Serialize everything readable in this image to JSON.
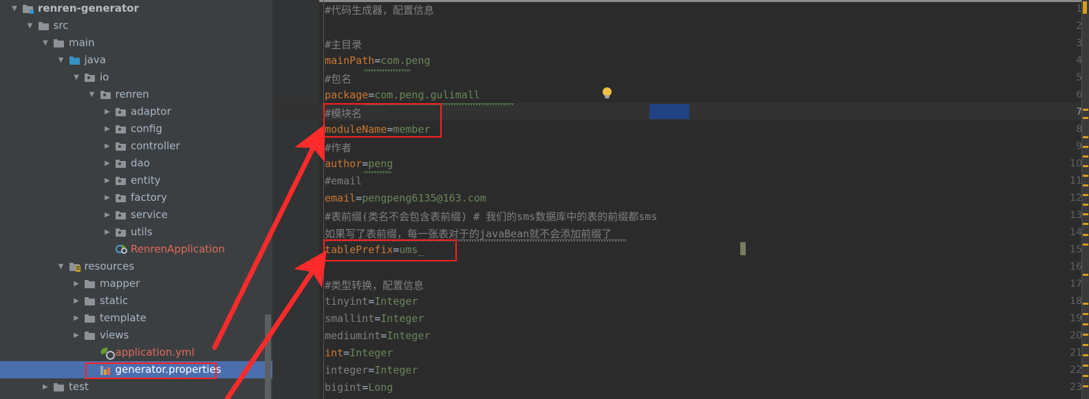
{
  "window": {
    "theme_bg": "#3c3f41",
    "editor_bg": "#2b2b2b",
    "accent_selection": "#4b6eaf",
    "annotation_color": "#ff2020"
  },
  "project_tree": {
    "name": "project-tool-window",
    "items": [
      {
        "label": "renren-generator",
        "indent": 0,
        "arrow": "down",
        "icon": "module-folder-icon",
        "style": "bold",
        "selected": false
      },
      {
        "label": "src",
        "indent": 1,
        "arrow": "down",
        "icon": "folder-icon",
        "style": "normal",
        "selected": false
      },
      {
        "label": "main",
        "indent": 2,
        "arrow": "down",
        "icon": "folder-icon",
        "style": "normal",
        "selected": false
      },
      {
        "label": "java",
        "indent": 3,
        "arrow": "down",
        "icon": "source-folder-icon",
        "style": "normal",
        "selected": false
      },
      {
        "label": "io",
        "indent": 4,
        "arrow": "down",
        "icon": "package-folder-icon",
        "style": "normal",
        "selected": false
      },
      {
        "label": "renren",
        "indent": 5,
        "arrow": "down",
        "icon": "package-folder-icon",
        "style": "normal",
        "selected": false
      },
      {
        "label": "adaptor",
        "indent": 6,
        "arrow": "right",
        "icon": "package-folder-icon",
        "style": "normal",
        "selected": false
      },
      {
        "label": "config",
        "indent": 6,
        "arrow": "right",
        "icon": "package-folder-icon",
        "style": "normal",
        "selected": false
      },
      {
        "label": "controller",
        "indent": 6,
        "arrow": "right",
        "icon": "package-folder-icon",
        "style": "normal",
        "selected": false
      },
      {
        "label": "dao",
        "indent": 6,
        "arrow": "right",
        "icon": "package-folder-icon",
        "style": "normal",
        "selected": false
      },
      {
        "label": "entity",
        "indent": 6,
        "arrow": "right",
        "icon": "package-folder-icon",
        "style": "normal",
        "selected": false
      },
      {
        "label": "factory",
        "indent": 6,
        "arrow": "right",
        "icon": "package-folder-icon",
        "style": "normal",
        "selected": false
      },
      {
        "label": "service",
        "indent": 6,
        "arrow": "right",
        "icon": "package-folder-icon",
        "style": "normal",
        "selected": false
      },
      {
        "label": "utils",
        "indent": 6,
        "arrow": "right",
        "icon": "package-folder-icon",
        "style": "normal",
        "selected": false
      },
      {
        "label": "RenrenApplication",
        "indent": 6,
        "arrow": "none",
        "icon": "spring-boot-class-icon",
        "style": "file-red",
        "selected": false
      },
      {
        "label": "resources",
        "indent": 3,
        "arrow": "down",
        "icon": "resources-folder-icon",
        "style": "normal",
        "selected": false
      },
      {
        "label": "mapper",
        "indent": 4,
        "arrow": "right",
        "icon": "folder-icon",
        "style": "normal",
        "selected": false
      },
      {
        "label": "static",
        "indent": 4,
        "arrow": "right",
        "icon": "folder-icon",
        "style": "normal",
        "selected": false
      },
      {
        "label": "template",
        "indent": 4,
        "arrow": "right",
        "icon": "folder-icon",
        "style": "normal",
        "selected": false
      },
      {
        "label": "views",
        "indent": 4,
        "arrow": "right",
        "icon": "folder-icon",
        "style": "normal",
        "selected": false
      },
      {
        "label": "application.yml",
        "indent": 5,
        "arrow": "none",
        "icon": "spring-yaml-icon",
        "style": "file-red",
        "selected": false
      },
      {
        "label": "generator.properties",
        "indent": 5,
        "arrow": "none",
        "icon": "properties-file-icon",
        "style": "file-sel",
        "selected": true
      },
      {
        "label": "test",
        "indent": 2,
        "arrow": "right",
        "icon": "folder-icon",
        "style": "normal",
        "selected": false
      }
    ]
  },
  "editor": {
    "name": "generator-properties-editor",
    "current_line": 7,
    "caret_line": 15,
    "caret_text_offset": "tablePrefix=ums_",
    "selection": {
      "line": 7,
      "text": "#模块名"
    },
    "intention_bulb_line": 6,
    "lines": [
      {
        "n": 1,
        "segments": [
          {
            "t": "#代码生成器，配置信息",
            "c": "cmt"
          }
        ]
      },
      {
        "n": 2,
        "segments": []
      },
      {
        "n": 3,
        "segments": [
          {
            "t": "#主目录",
            "c": "cmt"
          }
        ]
      },
      {
        "n": 4,
        "segments": [
          {
            "t": "mainPath",
            "c": "key"
          },
          {
            "t": "=",
            "c": "eq"
          },
          {
            "t": "com.peng",
            "c": "val"
          }
        ]
      },
      {
        "n": 5,
        "segments": [
          {
            "t": "#包名",
            "c": "cmt"
          }
        ]
      },
      {
        "n": 6,
        "segments": [
          {
            "t": "package",
            "c": "key"
          },
          {
            "t": "=",
            "c": "eq"
          },
          {
            "t": "com.peng.gulimall",
            "c": "val"
          }
        ]
      },
      {
        "n": 7,
        "segments": [
          {
            "t": "#模块名",
            "c": "cmt"
          }
        ]
      },
      {
        "n": 8,
        "segments": [
          {
            "t": "moduleName",
            "c": "key"
          },
          {
            "t": "=",
            "c": "eq"
          },
          {
            "t": "member",
            "c": "val"
          }
        ]
      },
      {
        "n": 9,
        "segments": [
          {
            "t": "#作者",
            "c": "cmt"
          }
        ]
      },
      {
        "n": 10,
        "segments": [
          {
            "t": "author",
            "c": "key"
          },
          {
            "t": "=",
            "c": "eq"
          },
          {
            "t": "peng",
            "c": "val"
          }
        ]
      },
      {
        "n": 11,
        "segments": [
          {
            "t": "#email",
            "c": "cmt"
          }
        ]
      },
      {
        "n": 12,
        "segments": [
          {
            "t": "email",
            "c": "key"
          },
          {
            "t": "=",
            "c": "eq"
          },
          {
            "t": "pengpeng6135@163.com",
            "c": "val"
          }
        ]
      },
      {
        "n": 13,
        "segments": [
          {
            "t": "#表前缀(类名不会包含表前缀) # 我们的sms数据库中的表的前缀都sms",
            "c": "cmt"
          }
        ]
      },
      {
        "n": 14,
        "segments": [
          {
            "t": "如果写了表前缀，每一张表对于的javaBean就不会添加前缀了",
            "c": "cmt"
          }
        ]
      },
      {
        "n": 15,
        "segments": [
          {
            "t": "tablePrefix",
            "c": "key"
          },
          {
            "t": "=",
            "c": "eq"
          },
          {
            "t": "ums_",
            "c": "val"
          }
        ]
      },
      {
        "n": 16,
        "segments": []
      },
      {
        "n": 17,
        "segments": [
          {
            "t": "#类型转换，配置信息",
            "c": "cmt"
          }
        ]
      },
      {
        "n": 18,
        "segments": [
          {
            "t": "tinyint",
            "c": "cmt"
          },
          {
            "t": "=",
            "c": "eq"
          },
          {
            "t": "Integer",
            "c": "val"
          }
        ]
      },
      {
        "n": 19,
        "segments": [
          {
            "t": "smallint",
            "c": "cmt"
          },
          {
            "t": "=",
            "c": "eq"
          },
          {
            "t": "Integer",
            "c": "val"
          }
        ]
      },
      {
        "n": 20,
        "segments": [
          {
            "t": "mediumint",
            "c": "cmt"
          },
          {
            "t": "=",
            "c": "eq"
          },
          {
            "t": "Integer",
            "c": "val"
          }
        ]
      },
      {
        "n": 21,
        "segments": [
          {
            "t": "int",
            "c": "key"
          },
          {
            "t": "=",
            "c": "eq"
          },
          {
            "t": "Integer",
            "c": "val"
          }
        ]
      },
      {
        "n": 22,
        "segments": [
          {
            "t": "integer",
            "c": "cmt"
          },
          {
            "t": "=",
            "c": "eq"
          },
          {
            "t": "Integer",
            "c": "val"
          }
        ]
      },
      {
        "n": 23,
        "segments": [
          {
            "t": "bigint",
            "c": "cmt"
          },
          {
            "t": "=",
            "c": "eq"
          },
          {
            "t": "Long",
            "c": "val"
          }
        ]
      }
    ]
  },
  "annotations": {
    "name": "red-annotations",
    "boxes": [
      {
        "label": "moduleName-box",
        "target": "lines 7-8"
      },
      {
        "label": "tablePrefix-box",
        "target": "line 15"
      },
      {
        "label": "generator-properties-box",
        "target": "generator.properties tree item"
      }
    ],
    "arrows": [
      {
        "label": "arrow-to-moduleName",
        "from": "generator.properties",
        "to": "moduleName=member"
      },
      {
        "label": "arrow-to-tablePrefix",
        "from": "generator.properties",
        "to": "tablePrefix=ums_"
      }
    ]
  },
  "marker_bar": {
    "name": "editor-marker-bar",
    "warning_color": "#d6a01d",
    "marker_positions": [
      158,
      170,
      198,
      212,
      226,
      240,
      254,
      268,
      282,
      296,
      310,
      324,
      340,
      354,
      398,
      440,
      455,
      470,
      485,
      500,
      515,
      530,
      545,
      560
    ]
  }
}
